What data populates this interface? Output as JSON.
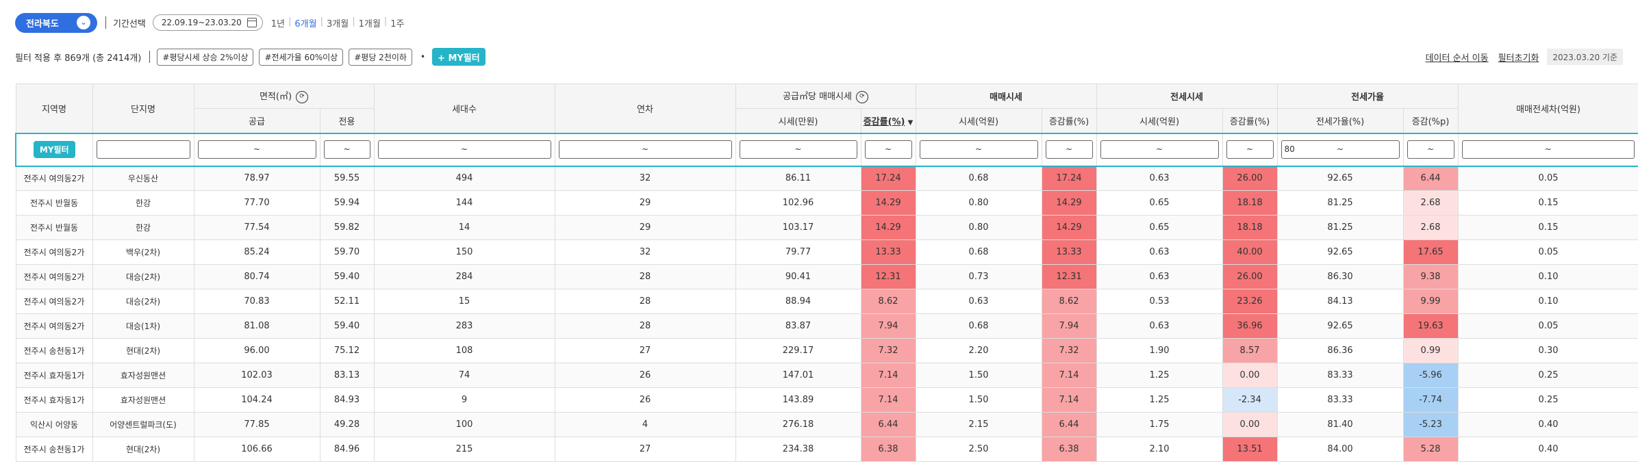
{
  "toolbar": {
    "region": "전라북도",
    "period_label": "기간선택",
    "date_range": "22.09.19~23.03.20",
    "periods": [
      "1년",
      "6개월",
      "3개월",
      "1개월",
      "1주"
    ],
    "active_period": 1
  },
  "filters": {
    "summary": "필터 적용 후 869개 (총 2414개)",
    "chips": [
      "#평당시세 상승 2%이상",
      "#전세가율 60%이상",
      "#평당 2천이하"
    ],
    "dot": "•",
    "my_filter_button": "+ MY필터",
    "move_order": "데이터 순서 이동",
    "reset": "필터초기화",
    "base_date": "2023.03.20 기준"
  },
  "headers": {
    "region": "지역명",
    "complex": "단지명",
    "area": "면적(㎡)",
    "area_supply": "공급",
    "area_private": "전용",
    "households": "세대수",
    "years": "연차",
    "price_per": "공급㎡당 매매시세",
    "price_per_value": "시세(만원)",
    "price_per_change": "증감률(%)",
    "sort_arrow": "▼",
    "sale": "매매시세",
    "sale_value": "시세(억원)",
    "sale_change": "증감률(%)",
    "jeonse": "전세시세",
    "jeonse_value": "시세(억원)",
    "jeonse_change": "증감률(%)",
    "ratio": "전세가율",
    "ratio_value": "전세가율(%)",
    "ratio_change": "증감(%p)",
    "gap": "매매전세차(억원)",
    "filter_icon": "⟳"
  },
  "filter_row": {
    "my_filter": "MY필터",
    "tilde": "~",
    "ratio_min": "80"
  },
  "colors": {
    "accent": "#2f6fe0",
    "teal": "#25b4c8",
    "red_strong": "#f47477",
    "red_mid": "#f8a3a5",
    "red_light": "#fde1e1",
    "blue_light": "#d5e7f8",
    "blue_mid": "#a7d0f4"
  },
  "rows": [
    [
      "전주시 여의동2가",
      "우신동산",
      "78.97",
      "59.55",
      "494",
      "32",
      "86.11",
      "17.24",
      "0.68",
      "17.24",
      "0.63",
      "26.00",
      "92.65",
      "6.44",
      "0.05"
    ],
    [
      "전주시 반월동",
      "한강",
      "77.70",
      "59.94",
      "144",
      "29",
      "102.96",
      "14.29",
      "0.80",
      "14.29",
      "0.65",
      "18.18",
      "81.25",
      "2.68",
      "0.15"
    ],
    [
      "전주시 반월동",
      "한강",
      "77.54",
      "59.82",
      "14",
      "29",
      "103.17",
      "14.29",
      "0.80",
      "14.29",
      "0.65",
      "18.18",
      "81.25",
      "2.68",
      "0.15"
    ],
    [
      "전주시 여의동2가",
      "백우(2차)",
      "85.24",
      "59.70",
      "150",
      "32",
      "79.77",
      "13.33",
      "0.68",
      "13.33",
      "0.63",
      "40.00",
      "92.65",
      "17.65",
      "0.05"
    ],
    [
      "전주시 여의동2가",
      "대승(2차)",
      "80.74",
      "59.40",
      "284",
      "28",
      "90.41",
      "12.31",
      "0.73",
      "12.31",
      "0.63",
      "26.00",
      "86.30",
      "9.38",
      "0.10"
    ],
    [
      "전주시 여의동2가",
      "대승(2차)",
      "70.83",
      "52.11",
      "15",
      "28",
      "88.94",
      "8.62",
      "0.63",
      "8.62",
      "0.53",
      "23.26",
      "84.13",
      "9.99",
      "0.10"
    ],
    [
      "전주시 여의동2가",
      "대승(1차)",
      "81.08",
      "59.40",
      "283",
      "28",
      "83.87",
      "7.94",
      "0.68",
      "7.94",
      "0.63",
      "36.96",
      "92.65",
      "19.63",
      "0.05"
    ],
    [
      "전주시 송천동1가",
      "현대(2차)",
      "96.00",
      "75.12",
      "108",
      "27",
      "229.17",
      "7.32",
      "2.20",
      "7.32",
      "1.90",
      "8.57",
      "86.36",
      "0.99",
      "0.30"
    ],
    [
      "전주시 효자동1가",
      "효자성원맨션",
      "102.03",
      "83.13",
      "74",
      "26",
      "147.01",
      "7.14",
      "1.50",
      "7.14",
      "1.25",
      "0.00",
      "83.33",
      "-5.96",
      "0.25"
    ],
    [
      "전주시 효자동1가",
      "효자성원맨션",
      "104.24",
      "84.93",
      "9",
      "26",
      "143.89",
      "7.14",
      "1.50",
      "7.14",
      "1.25",
      "-2.34",
      "83.33",
      "-7.74",
      "0.25"
    ],
    [
      "익산시 어양동",
      "어양센트럴파크(도)",
      "77.85",
      "49.28",
      "100",
      "4",
      "276.18",
      "6.44",
      "2.15",
      "6.44",
      "1.75",
      "0.00",
      "81.40",
      "-5.23",
      "0.40"
    ],
    [
      "전주시 송천동1가",
      "현대(2차)",
      "106.66",
      "84.96",
      "215",
      "27",
      "234.38",
      "6.38",
      "2.50",
      "6.38",
      "2.10",
      "13.51",
      "84.00",
      "5.28",
      "0.40"
    ]
  ]
}
